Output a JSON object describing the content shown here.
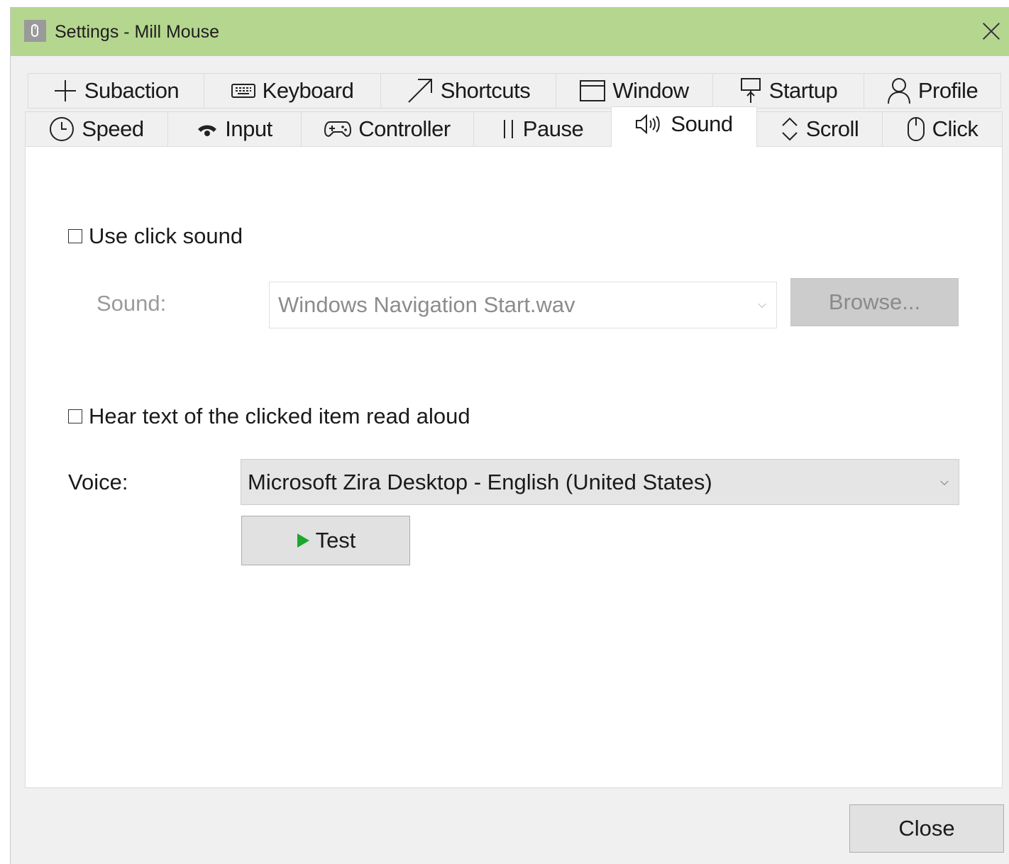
{
  "window": {
    "title": "Settings - Mill Mouse"
  },
  "tabs": {
    "row1": [
      {
        "label": "Subaction",
        "icon": "plus-icon"
      },
      {
        "label": "Keyboard",
        "icon": "keyboard-icon"
      },
      {
        "label": "Shortcuts",
        "icon": "arrow-diagonal-icon"
      },
      {
        "label": "Window",
        "icon": "window-icon"
      },
      {
        "label": "Startup",
        "icon": "startup-pin-icon"
      },
      {
        "label": "Profile",
        "icon": "person-icon"
      }
    ],
    "row2": [
      {
        "label": "Speed",
        "icon": "clock-icon"
      },
      {
        "label": "Input",
        "icon": "signal-icon"
      },
      {
        "label": "Controller",
        "icon": "gamepad-icon"
      },
      {
        "label": "Pause",
        "icon": "pause-icon"
      },
      {
        "label": "Sound",
        "icon": "speaker-icon",
        "active": true
      },
      {
        "label": "Scroll",
        "icon": "scroll-arrows-icon"
      },
      {
        "label": "Click",
        "icon": "mouse-icon"
      }
    ]
  },
  "sound": {
    "use_click_sound_label": "Use click sound",
    "use_click_sound_checked": false,
    "sound_label": "Sound:",
    "sound_value": "Windows Navigation Start.wav",
    "browse_label": "Browse...",
    "read_aloud_label": "Hear text of the clicked item read aloud",
    "read_aloud_checked": false,
    "voice_label": "Voice:",
    "voice_value": "Microsoft Zira Desktop - English (United States)",
    "test_label": "Test"
  },
  "footer": {
    "close_label": "Close"
  },
  "colors": {
    "titlebar": "#b5d68f",
    "play_icon": "#1aa82e",
    "disabled_text": "#9a9a9a"
  }
}
